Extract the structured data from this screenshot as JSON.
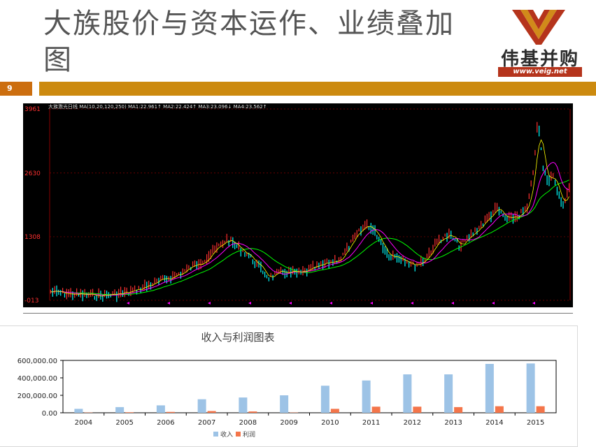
{
  "slide": {
    "title": "大族股价与资本运作、业绩叠加图",
    "page_number": "9"
  },
  "logo": {
    "name": "伟基并购",
    "url": "www.veig.net",
    "colors": [
      "#b5341c",
      "#d18a1a"
    ]
  },
  "stock_chart": {
    "header_text": "大族激光日线 MA(10,20,120,250) MA1:22.961↑ MA2:22.424↑ MA3:23.096↓ MA4:23.562↑",
    "price_labels": [
      "3961",
      "2630",
      "1308",
      "-013"
    ],
    "price_values": [
      3961,
      2630,
      1308,
      -13
    ],
    "colors": {
      "background": "#000000",
      "grid": "#8b0000",
      "label": "#ff3030",
      "candle_up": "#ff3030",
      "candle_down": "#00ffff",
      "ma_short": "#ffffff",
      "ma_mid": "#ffff00",
      "ma_120": "#ff00ff",
      "ma_250": "#00ff00"
    }
  },
  "chart_data": {
    "type": "bar",
    "title": "收入与利润图表",
    "categories": [
      "2004",
      "2005",
      "2006",
      "2007",
      "2008",
      "2009",
      "2010",
      "2011",
      "2012",
      "2013",
      "2014",
      "2015"
    ],
    "series": [
      {
        "name": "收入",
        "color": "#9dc3e6",
        "values": [
          45000,
          65000,
          85000,
          155000,
          175000,
          200000,
          310000,
          370000,
          440000,
          440000,
          560000,
          565000
        ]
      },
      {
        "name": "利润",
        "color": "#f4754a",
        "values": [
          3000,
          6000,
          10000,
          20000,
          15000,
          3000,
          45000,
          70000,
          70000,
          65000,
          75000,
          75000
        ]
      }
    ],
    "ylim": [
      0,
      600000
    ],
    "yticks": [
      "0.00",
      "200,000.00",
      "400,000.00",
      "600,000.00"
    ],
    "ytick_values": [
      0,
      200000,
      400000,
      600000
    ],
    "legend": "bottom",
    "grid": false
  }
}
